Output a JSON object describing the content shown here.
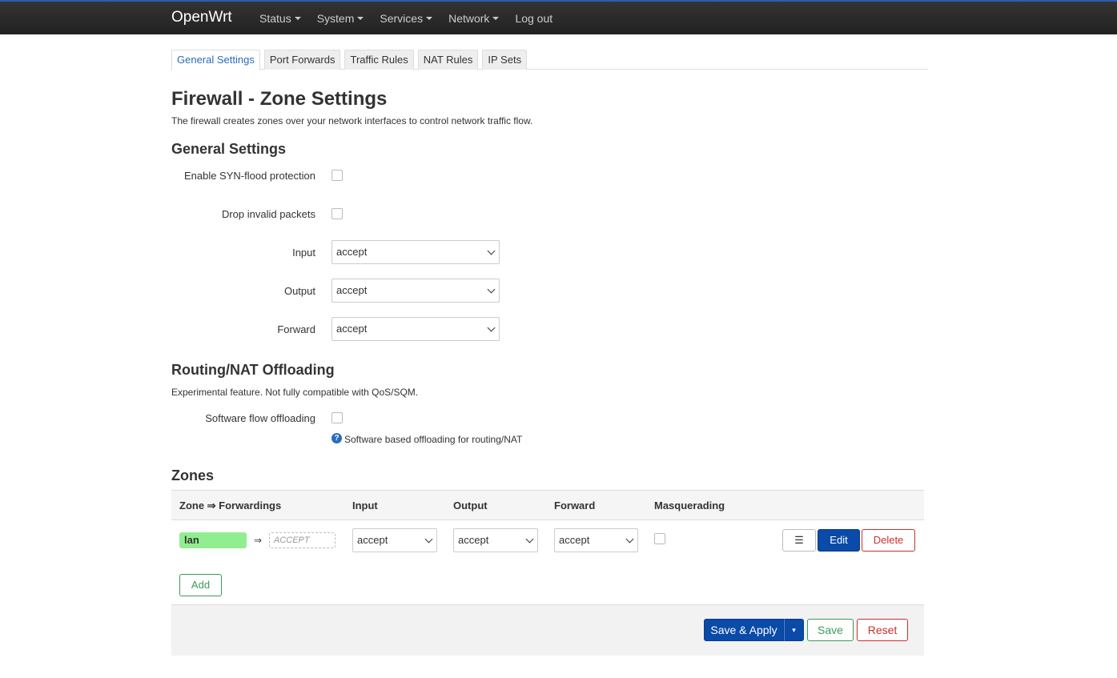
{
  "navbar": {
    "brand": "OpenWrt",
    "menu": [
      {
        "label": "Status",
        "has_caret": true
      },
      {
        "label": "System",
        "has_caret": true
      },
      {
        "label": "Services",
        "has_caret": true
      },
      {
        "label": "Network",
        "has_caret": true
      },
      {
        "label": "Log out",
        "has_caret": false
      }
    ]
  },
  "tabs": [
    {
      "label": "General Settings",
      "active": true
    },
    {
      "label": "Port Forwards",
      "active": false
    },
    {
      "label": "Traffic Rules",
      "active": false
    },
    {
      "label": "NAT Rules",
      "active": false
    },
    {
      "label": "IP Sets",
      "active": false
    }
  ],
  "page": {
    "title": "Firewall - Zone Settings",
    "description": "The firewall creates zones over your network interfaces to control network traffic flow."
  },
  "general": {
    "heading": "General Settings",
    "syn_flood_label": "Enable SYN-flood protection",
    "syn_flood_checked": false,
    "drop_invalid_label": "Drop invalid packets",
    "drop_invalid_checked": false,
    "input_label": "Input",
    "input_value": "accept",
    "output_label": "Output",
    "output_value": "accept",
    "forward_label": "Forward",
    "forward_value": "accept"
  },
  "offloading": {
    "heading": "Routing/NAT Offloading",
    "description": "Experimental feature. Not fully compatible with QoS/SQM.",
    "sw_flow_label": "Software flow offloading",
    "sw_flow_checked": false,
    "help_icon_glyph": "?",
    "help_text": "Software based offloading for routing/NAT"
  },
  "zones": {
    "heading": "Zones",
    "columns": [
      "Zone ⇒ Forwardings",
      "Input",
      "Output",
      "Forward",
      "Masquerading"
    ],
    "rows": [
      {
        "zone": "lan",
        "zone_color": "#90ee90",
        "arrow": "⇒",
        "forward_to": "ACCEPT",
        "input": "accept",
        "output": "accept",
        "forward": "accept",
        "masquerading": false,
        "menu_glyph": "☰",
        "edit_label": "Edit",
        "delete_label": "Delete"
      }
    ],
    "add_label": "Add"
  },
  "footer": {
    "save_apply_label": "Save & Apply",
    "dropdown_glyph": "▾",
    "save_label": "Save",
    "reset_label": "Reset"
  },
  "colors": {
    "accent": "#0a4aa8",
    "success": "#3a9c5a",
    "danger": "#c9302c"
  }
}
